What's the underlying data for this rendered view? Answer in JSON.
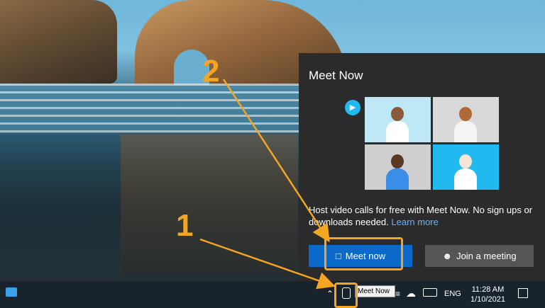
{
  "panel": {
    "title": "Meet Now",
    "description": "Host video calls for free with Meet Now. No sign ups or downloads needed.",
    "learn_more": "Learn more",
    "meet_now_label": "Meet now",
    "join_label": "Join a meeting"
  },
  "taskbar": {
    "tooltip": "Meet Now",
    "language": "ENG",
    "time": "11:28 AM",
    "date": "1/10/2021"
  },
  "annotations": {
    "step1": "1",
    "step2": "2"
  },
  "colors": {
    "accent": "#f5a524",
    "meet_button": "#0a69c9",
    "link": "#64b5ff"
  }
}
